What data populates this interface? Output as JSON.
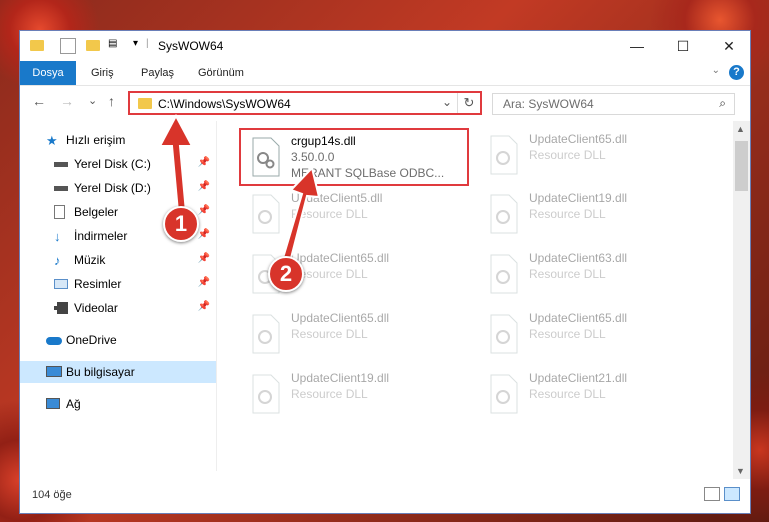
{
  "window": {
    "title": "SysWOW64",
    "controls": {
      "minimize": "—",
      "maximize": "☐",
      "close": "✕"
    }
  },
  "ribbon": {
    "tabs": [
      "Dosya",
      "Giriş",
      "Paylaş",
      "Görünüm"
    ],
    "help": "?"
  },
  "nav": {
    "back": "←",
    "forward": "→",
    "recent": "⌄",
    "up": "↑",
    "address": "C:\\Windows\\SysWOW64",
    "dropdown": "⌄",
    "refresh": "↻",
    "search_placeholder": "Ara: SysWOW64",
    "search_icon": "magnifier-icon"
  },
  "sidebar": {
    "items": [
      {
        "label": "Hızlı erişim",
        "icon": "star-icon"
      },
      {
        "label": "Yerel Disk (C:)",
        "icon": "drive-icon",
        "pinned": true
      },
      {
        "label": "Yerel Disk (D:)",
        "icon": "drive-icon",
        "pinned": true
      },
      {
        "label": "Belgeler",
        "icon": "documents-icon",
        "pinned": true
      },
      {
        "label": "İndirmeler",
        "icon": "download-icon",
        "pinned": true
      },
      {
        "label": "Müzik",
        "icon": "music-icon",
        "pinned": true
      },
      {
        "label": "Resimler",
        "icon": "pictures-icon",
        "pinned": true
      },
      {
        "label": "Videolar",
        "icon": "videos-icon",
        "pinned": true
      },
      {
        "label": "OneDrive",
        "icon": "cloud-icon"
      },
      {
        "label": "Bu bilgisayar",
        "icon": "computer-icon",
        "selected": true
      },
      {
        "label": "Ağ",
        "icon": "network-icon"
      }
    ]
  },
  "files": [
    {
      "name": "crgup14s.dll",
      "meta": "3.50.0.0",
      "desc": "MERANT SQLBase ODBC...",
      "highlighted": true
    },
    {
      "name": "UpdateClient65.dll",
      "meta": "Resource DLL"
    },
    {
      "name": "UpdateClient5.dll",
      "meta": "Resource DLL"
    },
    {
      "name": "UpdateClient19.dll",
      "meta": "Resource DLL"
    },
    {
      "name": "UpdateClient65.dll",
      "meta": "Resource DLL"
    },
    {
      "name": "UpdateClient63.dll",
      "meta": "Resource DLL"
    },
    {
      "name": "UpdateClient65.dll",
      "meta": "Resource DLL"
    },
    {
      "name": "UpdateClient65.dll",
      "meta": "Resource DLL"
    },
    {
      "name": "UpdateClient19.dll",
      "meta": "Resource DLL"
    },
    {
      "name": "UpdateClient21.dll",
      "meta": "Resource DLL"
    }
  ],
  "status": {
    "count": "104 öğe"
  },
  "annotations": {
    "step1": "1",
    "step2": "2"
  },
  "colors": {
    "accent": "#1979ca",
    "highlight": "#e03a3e",
    "selection": "#cce8ff"
  }
}
